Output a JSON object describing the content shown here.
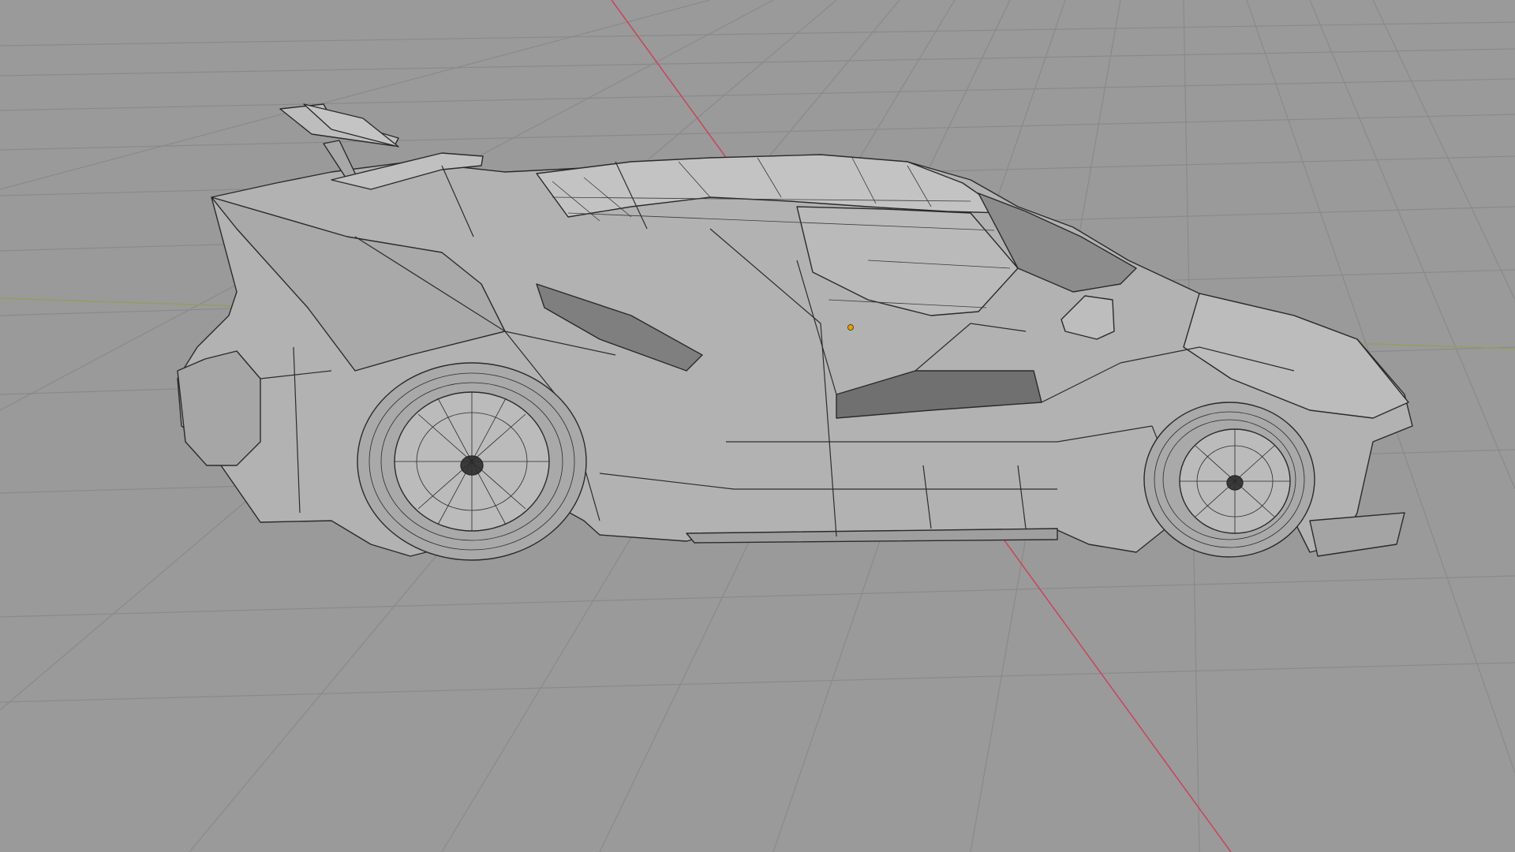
{
  "viewport": {
    "background_color": "#9a9a9a",
    "grid_color": "#888888",
    "x_axis_color": "#c8445a",
    "y_axis_color": "#8fa060",
    "object_origin_color": "#e8a000"
  },
  "object": {
    "type": "mesh",
    "description_icon": "sports-car-wireframe-mesh",
    "display_mode": "solid-with-wireframe",
    "mesh_color": "#b4b4b4",
    "edge_color": "#2a2a2a"
  }
}
